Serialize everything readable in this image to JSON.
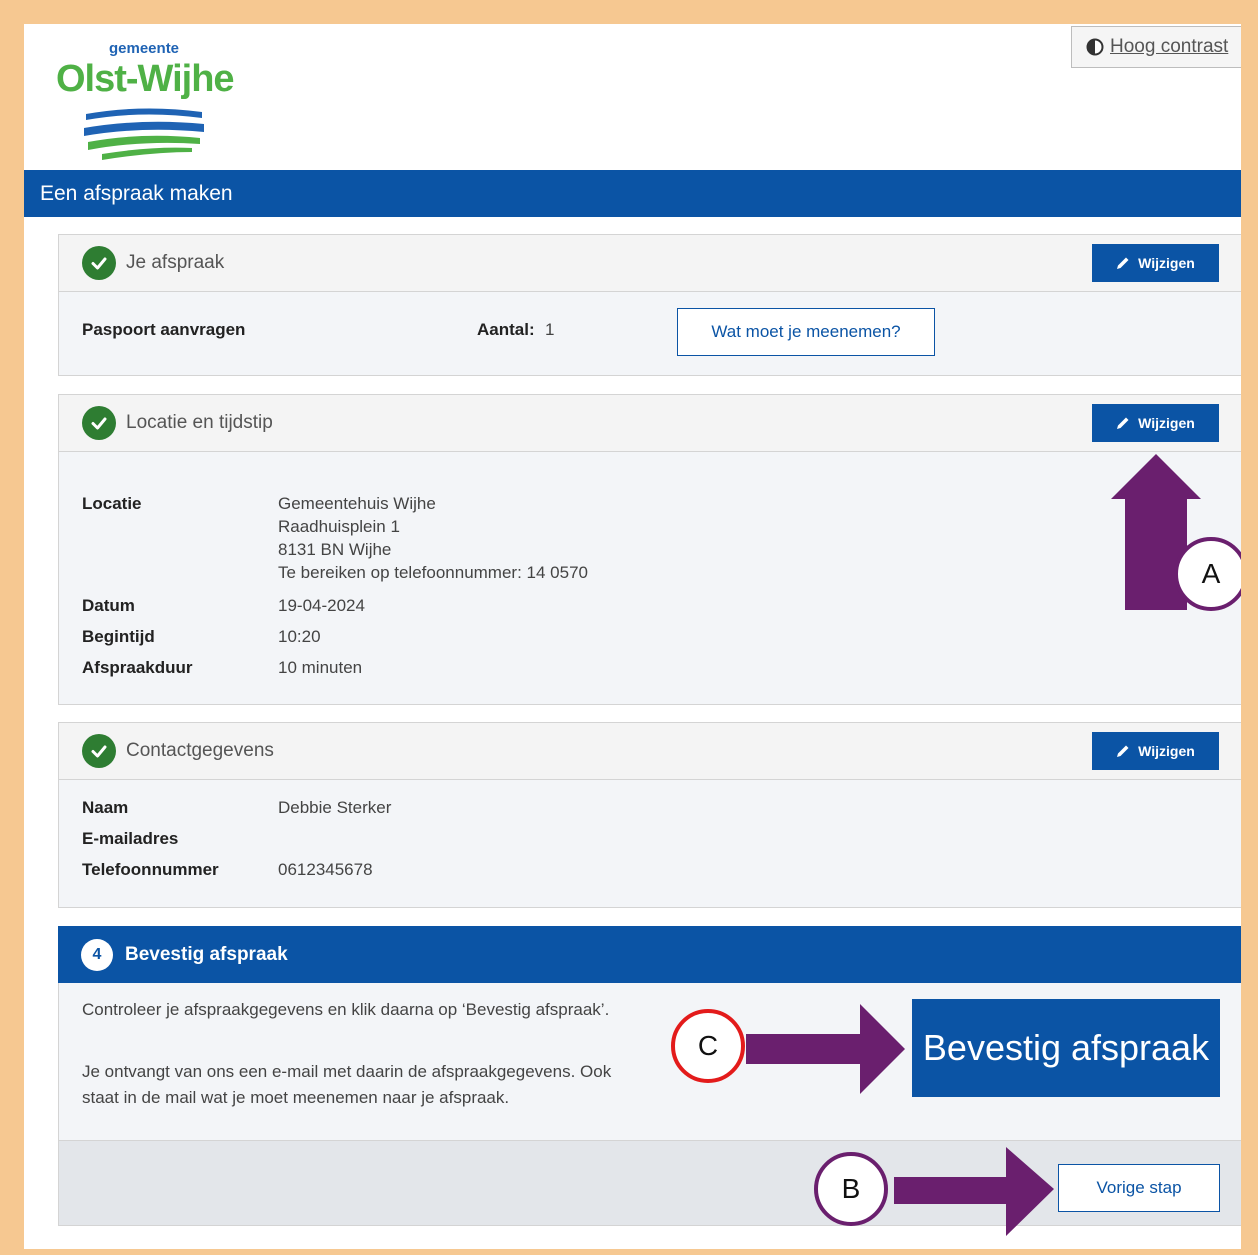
{
  "logo": {
    "small": "gemeente",
    "big": "Olst-Wijhe"
  },
  "contrast": {
    "label": "Hoog contrast"
  },
  "header": {
    "title": "Een afspraak maken"
  },
  "edit_label": "Wijzigen",
  "appointment": {
    "title": "Je afspraak",
    "product": "Paspoort aanvragen",
    "count_label": "Aantal:",
    "count_value": "1",
    "bring_button": "Wat moet je meenemen?"
  },
  "location": {
    "title": "Locatie en tijdstip",
    "location_label": "Locatie",
    "location_lines": [
      "Gemeentehuis Wijhe",
      "Raadhuisplein 1",
      "8131 BN Wijhe",
      "Te bereiken op telefoonnummer: 14 0570"
    ],
    "date_label": "Datum",
    "date_value": "19-04-2024",
    "start_label": "Begintijd",
    "start_value": "10:20",
    "duration_label": "Afspraakduur",
    "duration_value": "10 minuten"
  },
  "contact": {
    "title": "Contactgegevens",
    "name_label": "Naam",
    "name_value": "Debbie Sterker",
    "email_label": "E-mailadres",
    "email_value": "",
    "phone_label": "Telefoonnummer",
    "phone_value": "0612345678"
  },
  "confirm": {
    "step": "4",
    "title": "Bevestig afspraak",
    "text1": "Controleer je afspraakgegevens en klik daarna op ‘Bevestig afspraak’.",
    "text2": "Je ontvangt van ons een e-mail met daarin de afspraakgegevens. Ook staat in de mail wat je moet meenemen naar je afspraak.",
    "button": "Bevestig afspraak"
  },
  "previous": {
    "button": "Vorige stap"
  },
  "markers": {
    "a": "A",
    "b": "B",
    "c": "C"
  },
  "colors": {
    "primary": "#0b54a5",
    "check": "#2e7d32",
    "arrow": "#6a1f6e",
    "marker_c": "#e31b1b",
    "border": "#f6c891"
  }
}
